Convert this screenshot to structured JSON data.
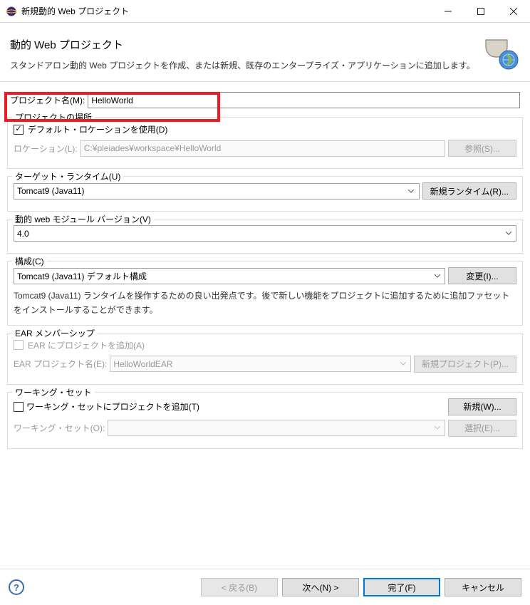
{
  "window": {
    "title": "新規動的 Web プロジェクト"
  },
  "header": {
    "title": "動的 Web プロジェクト",
    "desc": "スタンドアロン動的 Web プロジェクトを作成、または新規、既存のエンタープライズ・アプリケーションに追加します。"
  },
  "projectName": {
    "label": "プロジェクト名(M):",
    "value": "HelloWorld"
  },
  "location": {
    "legend": "プロジェクトの場所",
    "useDefaultLabel": "デフォルト・ロケーションを使用(D)",
    "useDefaultChecked": true,
    "locationLabel": "ロケーション(L):",
    "locationValue": "C:¥pleiades¥workspace¥HelloWorld",
    "browseBtn": "参照(S)..."
  },
  "runtime": {
    "legend": "ターゲット・ランタイム(U)",
    "value": "Tomcat9 (Java11)",
    "newBtn": "新規ランタイム(R)..."
  },
  "moduleVersion": {
    "legend": "動的 web モジュール バージョン(V)",
    "value": "4.0"
  },
  "config": {
    "legend": "構成(C)",
    "value": "Tomcat9 (Java11) デフォルト構成",
    "changeBtn": "変更(I)...",
    "desc": "Tomcat9 (Java11) ランタイムを操作するための良い出発点です。後で新しい機能をプロジェクトに追加するために追加ファセットをインストールすることができます。"
  },
  "ear": {
    "legend": "EAR メンバーシップ",
    "addLabel": "EAR にプロジェクトを追加(A)",
    "addChecked": false,
    "projectLabel": "EAR プロジェクト名(E):",
    "projectValue": "HelloWorldEAR",
    "newBtn": "新規プロジェクト(P)..."
  },
  "workingSet": {
    "legend": "ワーキング・セット",
    "addLabel": "ワーキング・セットにプロジェクトを追加(T)",
    "addChecked": false,
    "newBtn": "新規(W)...",
    "wsLabel": "ワーキング・セット(O):",
    "selectBtn": "選択(E)..."
  },
  "footer": {
    "back": "< 戻る(B)",
    "next": "次へ(N) >",
    "finish": "完了(F)",
    "cancel": "キャンセル"
  }
}
